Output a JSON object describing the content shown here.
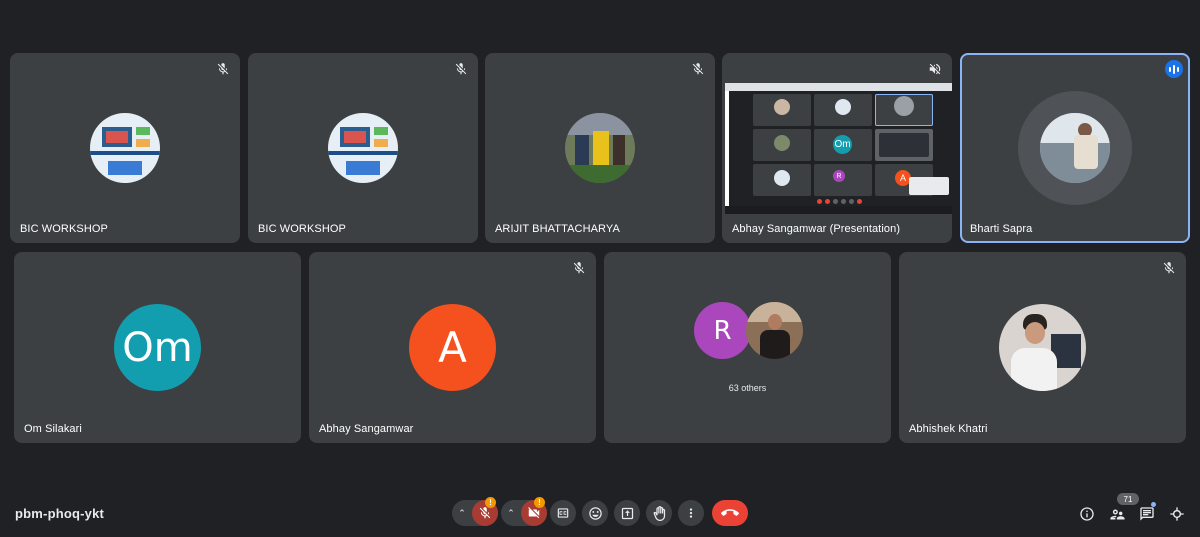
{
  "meeting": {
    "code": "pbm-phoq-ykt"
  },
  "participants": {
    "p1": {
      "name": "BIC WORKSHOP"
    },
    "p2": {
      "name": "BIC WORKSHOP"
    },
    "p3": {
      "name": "ARIJIT BHATTACHARYA"
    },
    "p4": {
      "name": "Abhay Sangamwar (Presentation)"
    },
    "p5": {
      "name": "Bharti Sapra"
    },
    "p6": {
      "name": "Om Silakari",
      "initials": "Om",
      "color": "#129eaf"
    },
    "p7": {
      "name": "Abhay Sangamwar",
      "initials": "A",
      "color": "#f4511e"
    },
    "p8": {
      "initials": "R",
      "color": "#ab47bc",
      "others_label": "63 others"
    },
    "p9": {
      "name": "Abhishek Khatri"
    }
  },
  "presentation_preview": {
    "tile_om": "Om",
    "tile_r": "R",
    "tile_a": "A"
  },
  "controls": {
    "mic_warning": "!",
    "cam_warning": "!",
    "people_count": "71"
  },
  "colors": {
    "background": "#202124",
    "tile": "#3c4043",
    "accent": "#8ab4f8",
    "danger": "#ea4335"
  }
}
